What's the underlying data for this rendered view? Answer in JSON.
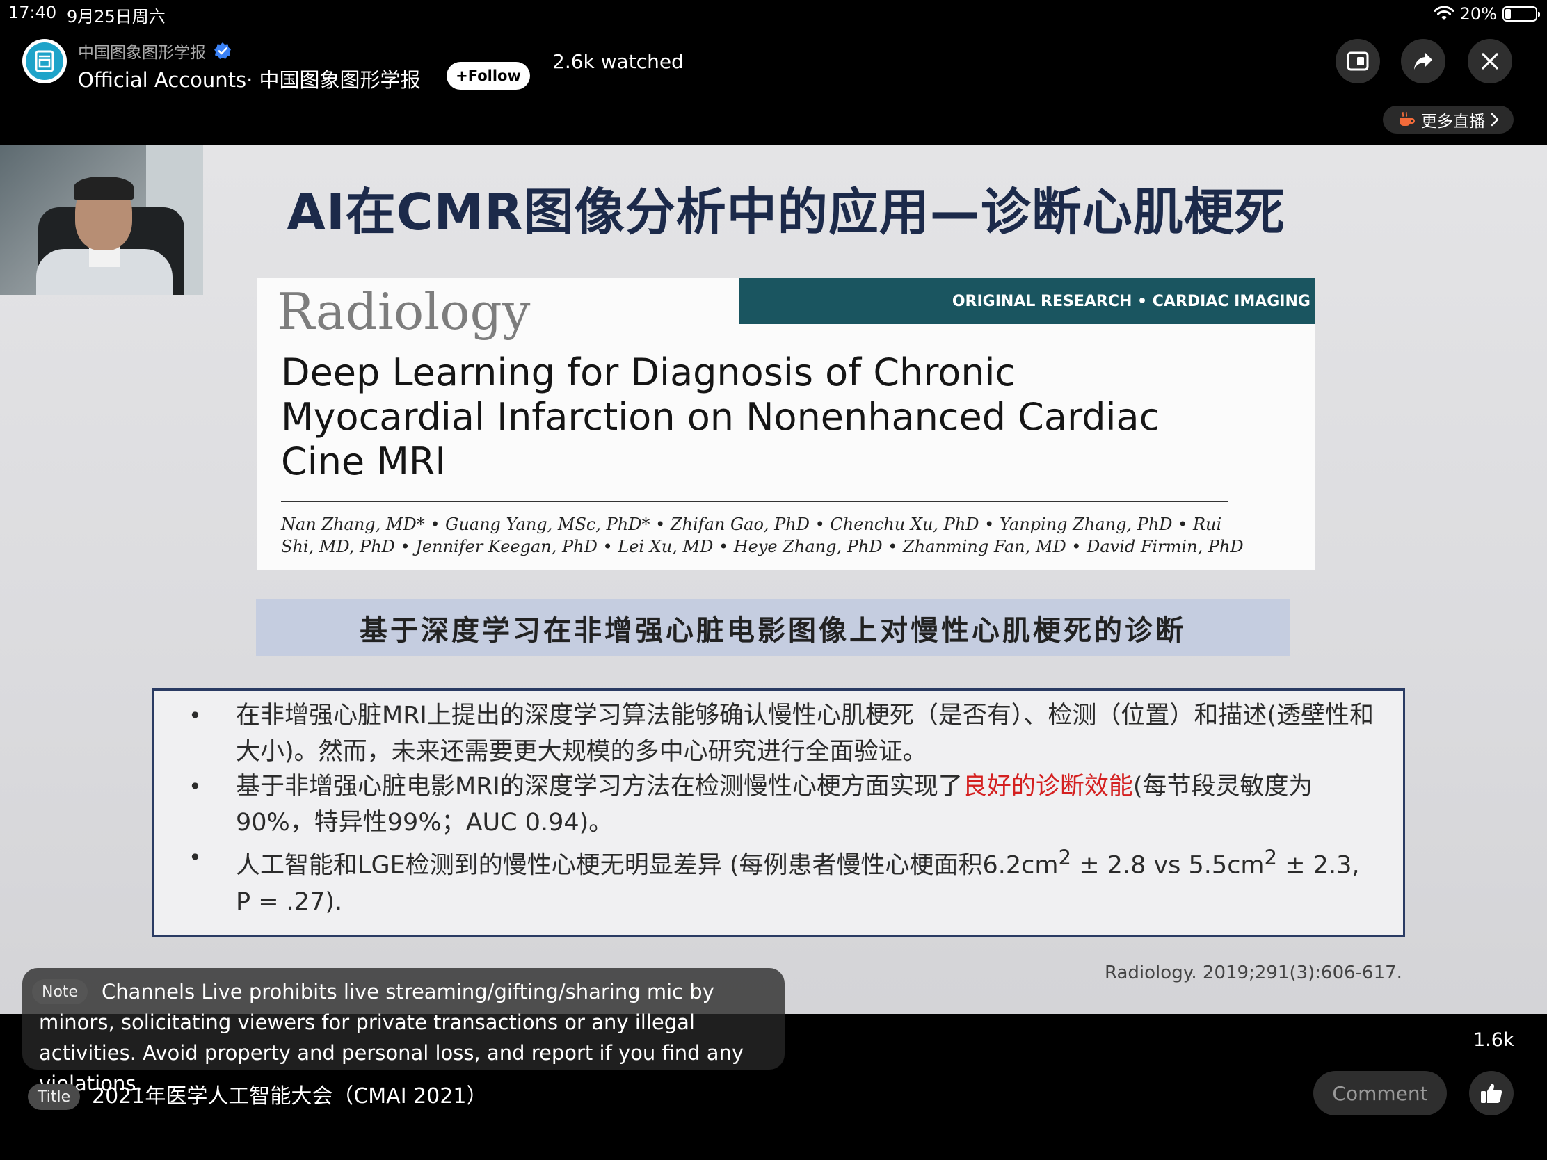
{
  "status_bar": {
    "time": "17:40",
    "date": "9月25日周六",
    "battery": "20%",
    "battery_level": 0.2
  },
  "header": {
    "account_name": "中国图象图形学报",
    "account_line": "Official Accounts· 中国图象图形学报",
    "follow_label": "+Follow",
    "watched": "2.6k watched",
    "more_live_label": "更多直播"
  },
  "slide": {
    "title": "AI在CMR图像分析中的应用—诊断心肌梗死",
    "journal": "Radiology",
    "section": "ORIGINAL RESEARCH • CARDIAC IMAGING",
    "paper_title_lines": [
      "Deep Learning for Diagnosis of Chronic",
      "Myocardial Infarction on Nonenhanced Cardiac",
      "Cine MRI"
    ],
    "authors_lines": [
      "Nan Zhang, MD* • Guang Yang, MSc, PhD* • Zhifan Gao, PhD • Chenchu Xu, PhD • Yanping Zhang, PhD • Rui",
      "Shi, MD, PhD • Jennifer Keegan, PhD • Lei Xu, MD • Heye Zhang, PhD • Zhanming Fan, MD • David Firmin, PhD"
    ],
    "chinese_subtitle": "基于深度学习在非增强心脏电影图像上对慢性心肌梗死的诊断",
    "findings": {
      "bullet": "•",
      "item1": "在非增强心脏MRI上提出的深度学习算法能够确认慢性心肌梗死（是否有）、检测（位置）和描述(透壁性和大小)。然而，未来还需要更大规模的多中心研究进行全面验证。",
      "item2_before": "基于非增强心脏电影MRI的深度学习方法在检测慢性心梗方面实现了",
      "item2_highlight": "良好的诊断效能",
      "item2_after": "(每节段灵敏度为90%，特异性99%；AUC 0.94)。",
      "item3_a": "人工智能和LGE检测到的慢性心梗无明显差异 (每例患者慢性心梗面积6.2cm",
      "item3_sup1": "2",
      "item3_b": " ± 2.8 vs 5.5cm",
      "item3_sup2": "2",
      "item3_c": " ± 2.3, P = .27)."
    },
    "citation": "Radiology. 2019;291(3):606-617."
  },
  "overlay": {
    "note_tag": "Note",
    "note_text": "Channels Live prohibits live streaming/gifting/sharing mic by minors, solicitating viewers for private transactions or any illegal activities. Avoid property and personal loss, and report if you find any violations.",
    "title_tag": "Title",
    "title_text": "2021年医学人工智能大会（CMAI 2021）",
    "like_count": "1.6k",
    "comment_label": "Comment"
  },
  "colors": {
    "accent_banner": "#1a5560",
    "highlight": "#d42020",
    "verified": "#3b82f6",
    "avatar": "#1ea3c9"
  },
  "icons": [
    "wifi-icon",
    "battery-icon",
    "verified-icon",
    "pip-icon",
    "share-icon",
    "close-icon",
    "cup-icon",
    "chevron-right-icon",
    "thumbs-up-icon"
  ]
}
